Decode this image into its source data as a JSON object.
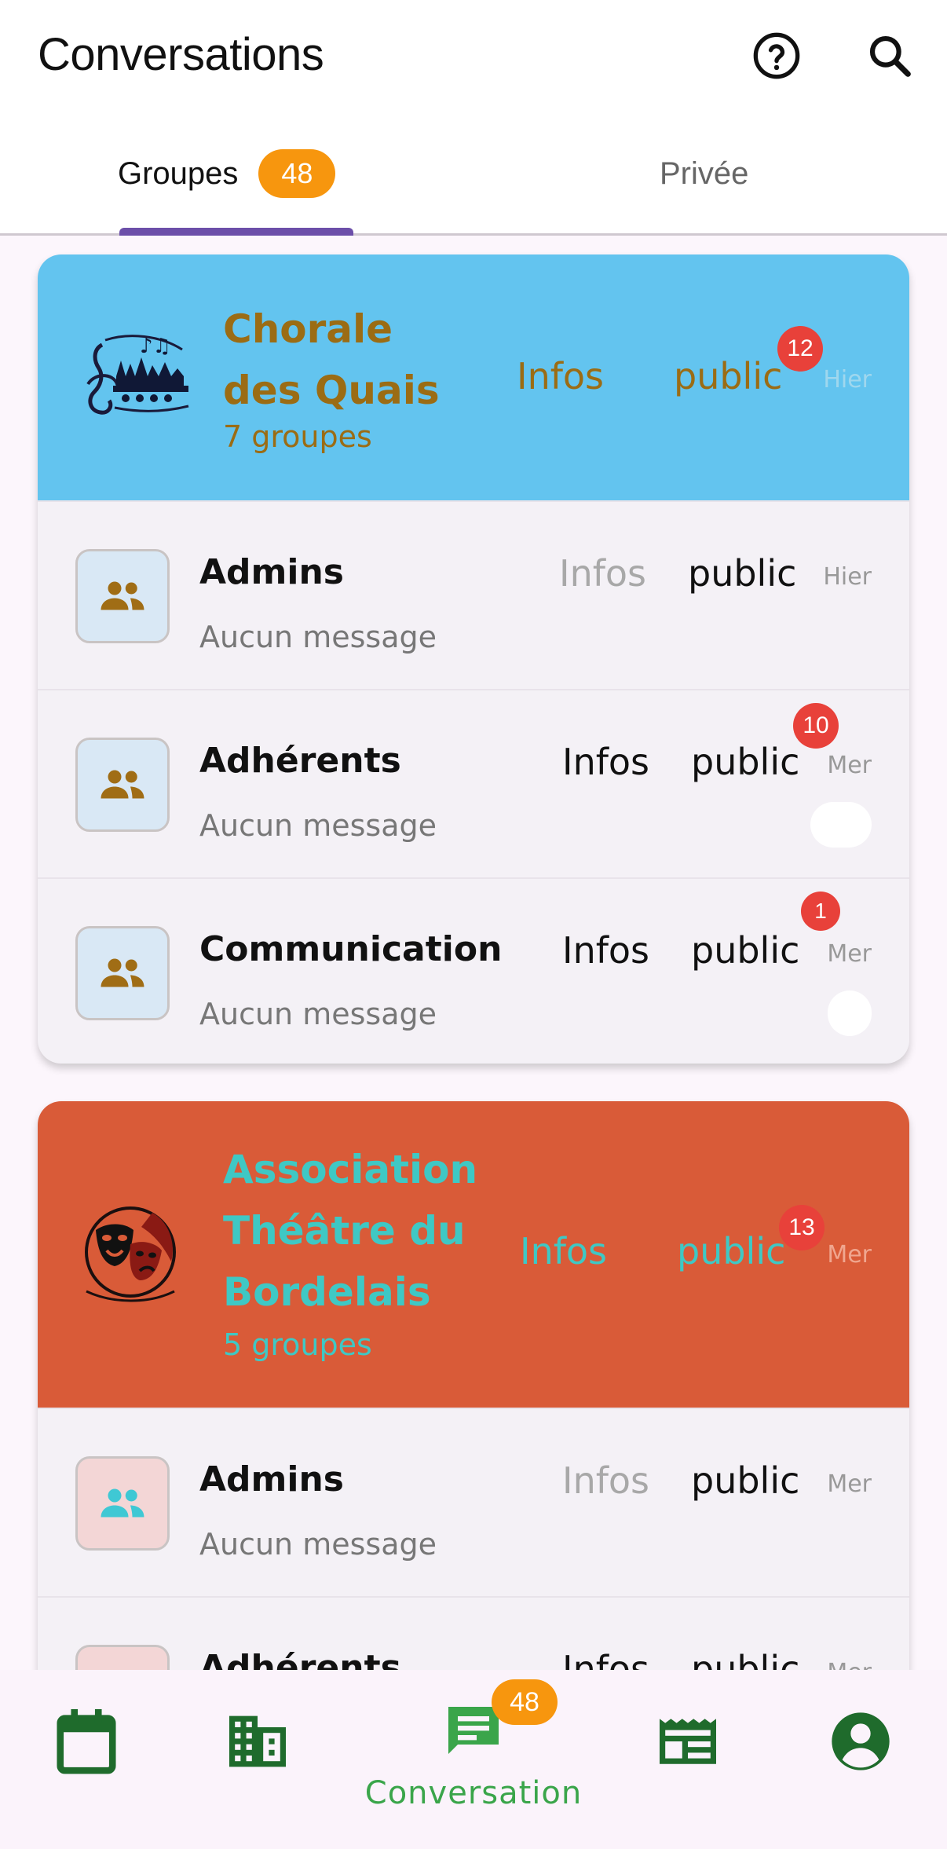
{
  "app_bar": {
    "title": "Conversations",
    "help_icon": "help-circle-icon",
    "search_icon": "search-icon"
  },
  "tabs": [
    {
      "label": "Groupes",
      "badge": "48",
      "selected": true
    },
    {
      "label": "Privée",
      "selected": false
    }
  ],
  "colors": {
    "accent_purple": "#6c4fa9",
    "badge_orange": "#f7960e",
    "badge_red": "#e8413a",
    "nav_green": "#1f6b2c",
    "chorale_header_bg": "#63c4ef",
    "chorale_text": "#9b6c14",
    "theatre_header_bg": "#d95b38",
    "theatre_text": "#3fc8c4"
  },
  "associations": [
    {
      "name": "Chorale des Quais",
      "name_line1": "Chorale",
      "name_line2": "des Quais",
      "subtitle": "7 groupes",
      "infos": "Infos",
      "visibility": "public",
      "badge": "12",
      "date": "Hier",
      "groups": [
        {
          "name": "Admins",
          "message": "Aucun message",
          "infos": "Infos",
          "visibility": "public",
          "date": "Hier",
          "badge": null
        },
        {
          "name": "Adhérents",
          "message": "Aucun message",
          "infos": "Infos",
          "visibility": "public",
          "date": "Mer",
          "badge": "10"
        },
        {
          "name": "Communication",
          "message": "Aucun message",
          "infos": "Infos",
          "visibility": "public",
          "date": "Mer",
          "badge": "1"
        }
      ]
    },
    {
      "name": "Association Théâtre du Bordelais",
      "name_line1": "Association",
      "name_line2": "Théâtre du",
      "name_line3": "Bordelais",
      "subtitle": "5 groupes",
      "infos": "Infos",
      "visibility": "public",
      "badge": "13",
      "date": "Mer",
      "groups": [
        {
          "name": "Admins",
          "message": "Aucun message",
          "infos": "Infos",
          "visibility": "public",
          "date": "Mer",
          "badge": null
        },
        {
          "name": "Adhérents",
          "message": "",
          "infos": "Infos",
          "visibility": "public",
          "date": "Mer",
          "badge": null
        }
      ]
    }
  ],
  "bottom_nav": [
    {
      "icon": "calendar-icon"
    },
    {
      "icon": "building-icon"
    },
    {
      "icon": "chat-icon",
      "label": "Conversation",
      "badge": "48",
      "selected": true
    },
    {
      "icon": "newspaper-icon"
    },
    {
      "icon": "account-circle-icon"
    }
  ]
}
